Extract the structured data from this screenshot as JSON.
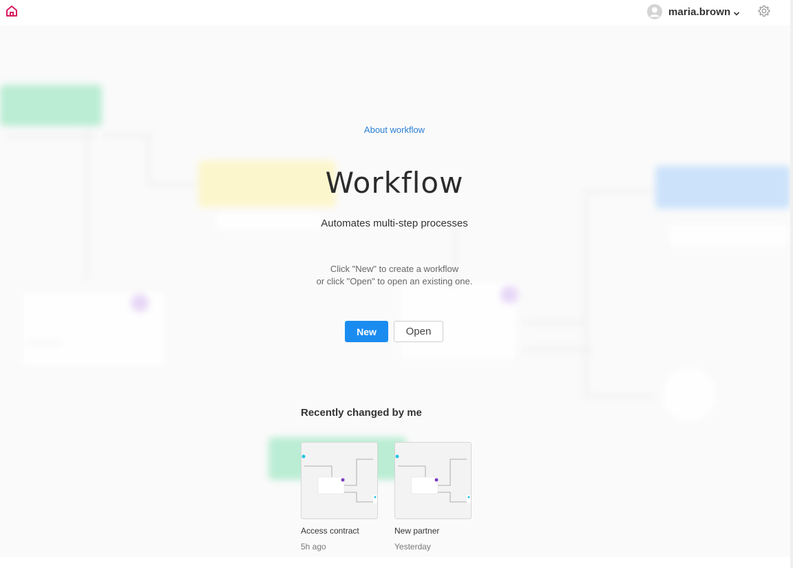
{
  "header": {
    "home_icon": "home-icon",
    "user": {
      "name": "maria.brown",
      "avatar_icon": "user-avatar-icon",
      "menu_icon": "chevron-down-icon"
    },
    "settings_icon": "gear-icon",
    "accent_color": "#d81b60"
  },
  "intro": {
    "about_link": "About workflow",
    "title": "Workflow",
    "subtitle": "Automates multi-step processes",
    "hint_line1": "Click \"New\" to create a workflow",
    "hint_line2": "or click \"Open\" to open an existing one."
  },
  "actions": {
    "new_label": "New",
    "open_label": "Open",
    "primary_color": "#1a8cf0"
  },
  "recent": {
    "title": "Recently changed by me",
    "items": [
      {
        "name": "Access contract",
        "time": "5h ago"
      },
      {
        "name": "New partner",
        "time": "Yesterday"
      }
    ]
  }
}
